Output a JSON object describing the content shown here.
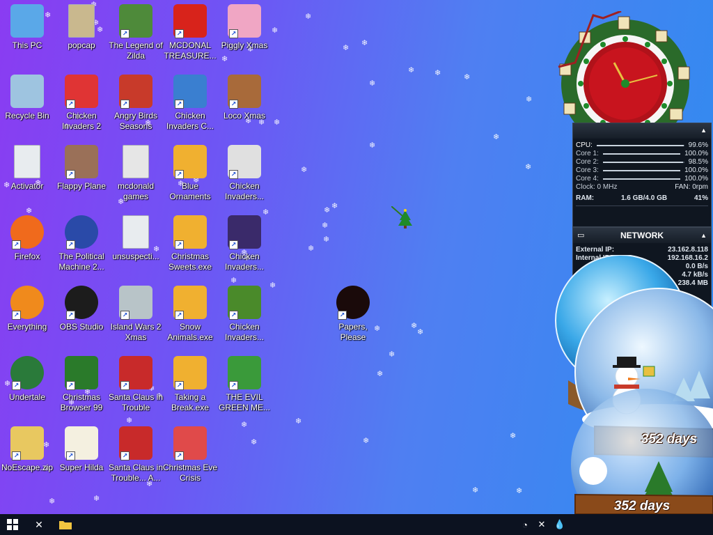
{
  "desktop": {
    "icons": [
      {
        "label": "This PC",
        "icon": "computer-icon",
        "color": "#5aa8e8"
      },
      {
        "label": "popcap",
        "icon": "folder-icon",
        "color": "#c9b88e"
      },
      {
        "label": "The Legend of Zilda",
        "icon": "game-character-icon",
        "color": "#4e8a3a"
      },
      {
        "label": "MCDONAL TREASURE...",
        "icon": "mcdonalds-icon",
        "color": "#d8231b"
      },
      {
        "label": "Piggly Xmas",
        "icon": "pig-icon",
        "color": "#f0a6c4"
      },
      {
        "label": "Recycle Bin",
        "icon": "recycle-bin-icon",
        "color": "#9ec4e0"
      },
      {
        "label": "Chicken Invaders 2",
        "icon": "chicken-icon",
        "color": "#e03434"
      },
      {
        "label": "Angry Birds Seasons",
        "icon": "angry-bird-icon",
        "color": "#c83a2a"
      },
      {
        "label": "Chicken Invaders C...",
        "icon": "snowman-icon",
        "color": "#3a7fd0"
      },
      {
        "label": "Loco Xmas",
        "icon": "bear-icon",
        "color": "#a86a3a"
      },
      {
        "label": "Activator",
        "icon": "file-icon",
        "color": "#e8ecef"
      },
      {
        "label": "Flappy Plane",
        "icon": "photo-icon",
        "color": "#9a7058"
      },
      {
        "label": "mcdonald games",
        "icon": "folder-icon",
        "color": "#e6e6e6"
      },
      {
        "label": "Blue Ornaments",
        "icon": "puzzle-icon",
        "color": "#f0b030"
      },
      {
        "label": "Chicken Invaders...",
        "icon": "chicken-icon",
        "color": "#e0e0e0"
      },
      {
        "label": "Firefox",
        "icon": "firefox-icon",
        "color": "#f06a1c"
      },
      {
        "label": "The Political Machine 2...",
        "icon": "badge-2020-icon",
        "color": "#2a4aa8"
      },
      {
        "label": "unsuspecti...",
        "icon": "file-icon",
        "color": "#e8ecef"
      },
      {
        "label": "Christmas Sweets.exe",
        "icon": "puzzle-icon",
        "color": "#f0b030"
      },
      {
        "label": "Chicken Invaders...",
        "icon": "chicken-icon",
        "color": "#3a2a6a"
      },
      {
        "label": "Everything",
        "icon": "search-icon",
        "color": "#f08a1c"
      },
      {
        "label": "OBS Studio",
        "icon": "obs-icon",
        "color": "#1c1c1c"
      },
      {
        "label": "Island Wars 2 Xmas",
        "icon": "island-icon",
        "color": "#b8c4c8"
      },
      {
        "label": "Snow Animals.exe",
        "icon": "puzzle-icon",
        "color": "#f0b030"
      },
      {
        "label": "Chicken Invaders...",
        "icon": "chicken-icon",
        "color": "#4a8a2a"
      },
      {
        "label": "Papers, Please",
        "icon": "papers-please-icon",
        "color": "#1a0a0a"
      },
      {
        "label": "Undertale",
        "icon": "undertale-icon",
        "color": "#2a7a3a"
      },
      {
        "label": "Christmas Browser 99",
        "icon": "christmas-tree-icon",
        "color": "#2a7a2a"
      },
      {
        "label": "Santa Claus in Trouble",
        "icon": "santa-icon",
        "color": "#c82a2a"
      },
      {
        "label": "Taking a Break.exe",
        "icon": "puzzle-icon",
        "color": "#f0b030"
      },
      {
        "label": "THE EVIL GREEN ME...",
        "icon": "messenger-icon",
        "color": "#3a9a3a"
      },
      {
        "label": "NoEscape.zip",
        "icon": "zip-folder-icon",
        "color": "#e8c860"
      },
      {
        "label": "Super Hilda",
        "icon": "pixel-art-icon",
        "color": "#f4f0e0"
      },
      {
        "label": "Santa Claus in Trouble... A...",
        "icon": "santa-icon",
        "color": "#c82a2a"
      },
      {
        "label": "Christmas Eve Crisis",
        "icon": "santa-icon",
        "color": "#e04a4a"
      }
    ]
  },
  "monitor": {
    "rows": [
      {
        "k": "CPU:",
        "v": "99.6%",
        "level": 0.996
      },
      {
        "k": "Core 1:",
        "v": "100.0%",
        "level": 1.0
      },
      {
        "k": "Core 2:",
        "v": "98.5%",
        "level": 0.985
      },
      {
        "k": "Core 3:",
        "v": "100.0%",
        "level": 1.0
      },
      {
        "k": "Core 4:",
        "v": "100.0%",
        "level": 1.0
      }
    ],
    "clock_label": "Clock: 0 MHz",
    "fan_label": "FAN: 0rpm",
    "ram_label": "RAM:",
    "ram_value": "1.6 GB/4.0 GB",
    "ram_pct": "41%"
  },
  "network": {
    "title": "NETWORK",
    "rows": [
      {
        "k": "External IP:",
        "v": "23.162.8.118"
      },
      {
        "k": "Internal IP:",
        "v": "192.168.16.2"
      },
      {
        "k": "",
        "v": "0.0 B/s"
      },
      {
        "k": "",
        "v": "4.7 kB/s"
      },
      {
        "k": "",
        "v": "238.4 MB"
      }
    ]
  },
  "snowglobe": {
    "days_text_1": "352 days",
    "days_text_2": "352 days"
  },
  "taskbar": {
    "start": "start-icon",
    "tray_icons": [
      "clock-icon",
      "settings-icon",
      "drop-icon",
      "volume-icon"
    ]
  }
}
